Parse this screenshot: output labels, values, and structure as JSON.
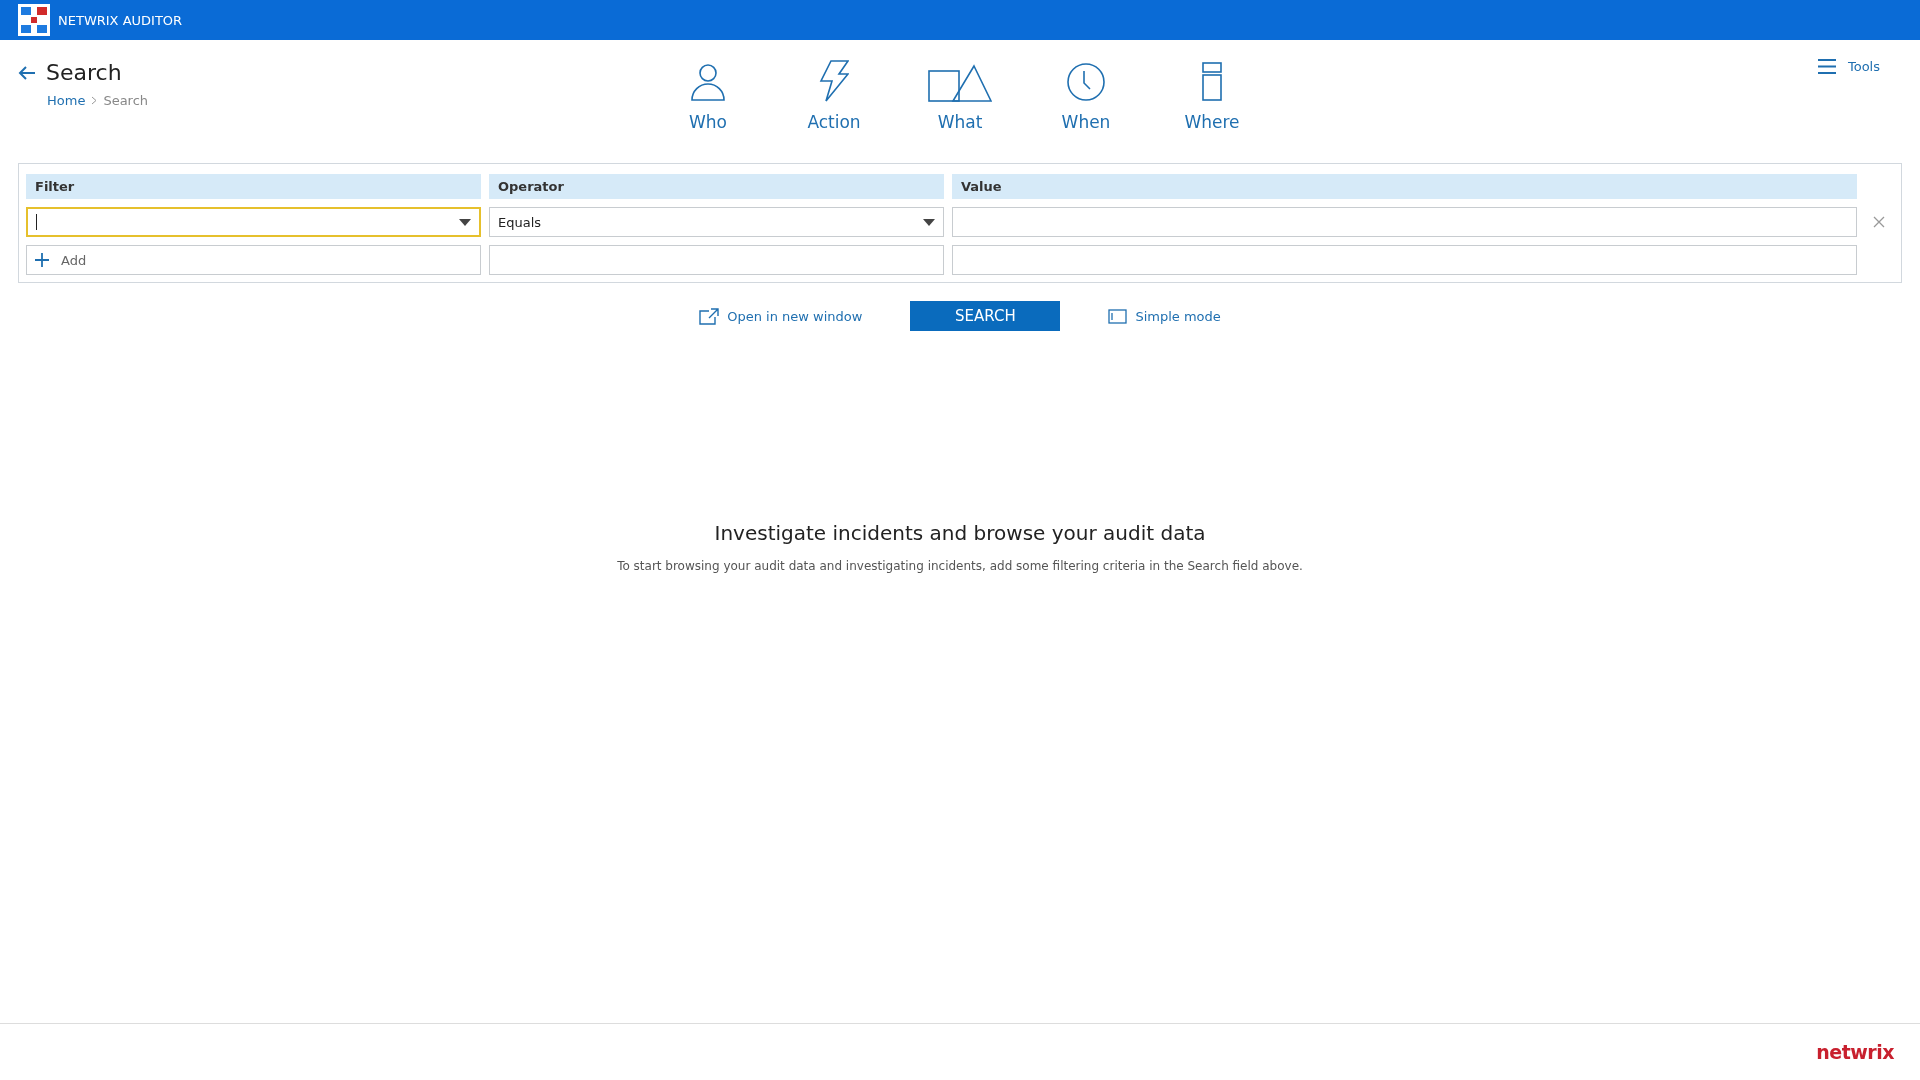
{
  "app_bar": {
    "title": "NETWRIX AUDITOR"
  },
  "header": {
    "title": "Search",
    "breadcrumb": [
      {
        "label": "Home",
        "link": true
      },
      {
        "label": "Search",
        "link": false
      }
    ],
    "tools": "Tools"
  },
  "categories": [
    {
      "label": "Who",
      "kind": "person"
    },
    {
      "label": "Action",
      "kind": "bolt"
    },
    {
      "label": "What",
      "kind": "shapes"
    },
    {
      "label": "When",
      "kind": "clock"
    },
    {
      "label": "Where",
      "kind": "server"
    }
  ],
  "filter_table": {
    "columns": [
      "Filter",
      "Operator",
      "Value"
    ],
    "rows": [
      {
        "filter": "",
        "operator": "Equals",
        "value": "",
        "focused": true
      }
    ],
    "add_label": "Add"
  },
  "actions": {
    "open_new_window": "Open in new window",
    "search": "SEARCH",
    "simple_mode": "Simple mode"
  },
  "empty_state": {
    "heading": "Investigate incidents and browse your audit data",
    "text": "To start browsing your audit data and investigating incidents, add some filtering criteria in the Search field above."
  },
  "footer": {
    "logo": "netwrix"
  }
}
